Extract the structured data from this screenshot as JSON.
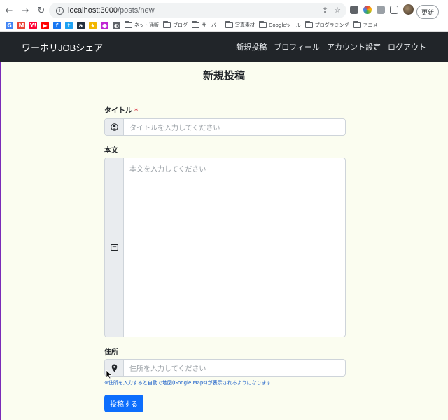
{
  "browser": {
    "url_host": "localhost:3000",
    "url_path": "/posts/new",
    "update_label": "更新",
    "bookmarks": [
      {
        "icon": "google-icon",
        "letter": "G",
        "color": "#4285f4"
      },
      {
        "icon": "gmail-icon",
        "letter": "M",
        "color": "#ea4335"
      },
      {
        "icon": "yahoo-icon",
        "letter": "Y!",
        "color": "#ff0033"
      },
      {
        "icon": "youtube-icon",
        "letter": "▶",
        "color": "#ff0000"
      },
      {
        "icon": "facebook-icon",
        "letter": "f",
        "color": "#1877f2"
      },
      {
        "icon": "twitter-icon",
        "letter": "t",
        "color": "#1da1f2"
      },
      {
        "icon": "amazon-icon",
        "letter": "a",
        "color": "#232f3e"
      },
      {
        "icon": "star-icon",
        "letter": "★",
        "color": "#f2b600"
      },
      {
        "icon": "app-icon",
        "letter": "●",
        "color": "#c026d3"
      },
      {
        "icon": "app2-icon",
        "letter": "◐",
        "color": "#5f6368"
      }
    ],
    "folders": [
      "ネット通販",
      "ブログ",
      "サーバー",
      "写真素材",
      "Googleツール",
      "プログラミング",
      "アニメ"
    ]
  },
  "app": {
    "brand": "ワーホリJOBシェア",
    "nav": [
      "新規投稿",
      "プロフィール",
      "アカウント設定",
      "ログアウト"
    ]
  },
  "form": {
    "page_title": "新規投稿",
    "title_label": "タイトル",
    "required_mark": "*",
    "title_placeholder": "タイトルを入力してください",
    "body_label": "本文",
    "body_placeholder": "本文を入力してください",
    "address_label": "住所",
    "address_placeholder": "住所を入力してください",
    "address_help": "※住所を入力すると自動で地図(Google Maps)が表示されるようになります",
    "submit_label": "投稿する"
  },
  "colors": {
    "navbar": "#212529",
    "submit": "#0d6efd",
    "required": "#dc3545",
    "help_text": "#1b5fc9",
    "page_bg": "#fbfdf0"
  }
}
